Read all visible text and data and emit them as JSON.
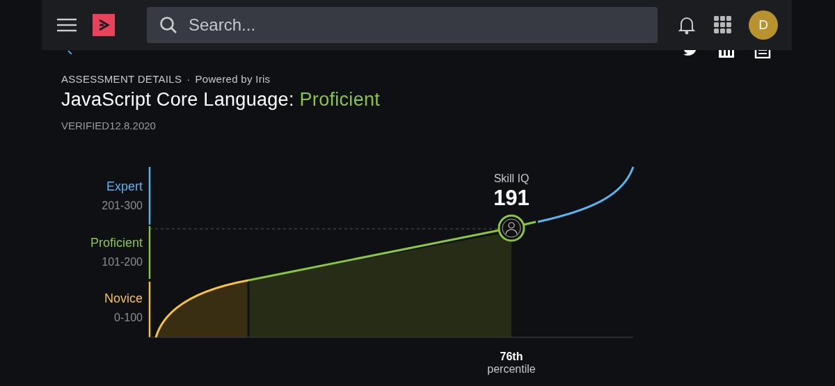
{
  "header": {
    "search": {
      "placeholder": "Search..."
    },
    "avatar": {
      "initial": "D"
    }
  },
  "breadcrumb": {
    "section": "ASSESSMENT DETAILS",
    "separator": "·",
    "powered_by": "Powered by Iris"
  },
  "title": {
    "subject": "JavaScript Core Language:",
    "level": "Proficient"
  },
  "verified": "VERIFIED12.8.2020",
  "levels": [
    {
      "name": "Expert",
      "range": "201-300",
      "color": "#5ab4ee"
    },
    {
      "name": "Proficient",
      "range": "101-200",
      "color": "#8cc63f"
    },
    {
      "name": "Novice",
      "range": "0-100",
      "color": "#f5c242"
    }
  ],
  "skill_iq": {
    "label": "Skill IQ",
    "value": "191"
  },
  "percentile": {
    "value": "76th",
    "label": "percentile"
  }
}
